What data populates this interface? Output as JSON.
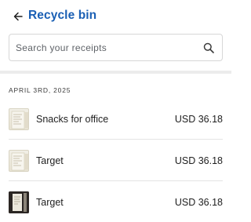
{
  "header": {
    "title": "Recycle bin"
  },
  "search": {
    "placeholder": "Search your receipts",
    "value": ""
  },
  "section": {
    "date_label": "April 3rd, 2025"
  },
  "receipts": [
    {
      "name": "Snacks for office",
      "amount": "USD 36.18",
      "thumbnail": "receipt-photo-light"
    },
    {
      "name": "Target",
      "amount": "USD 36.18",
      "thumbnail": "receipt-photo-light"
    },
    {
      "name": "Target",
      "amount": "USD 36.18",
      "thumbnail": "receipt-photo-dark"
    }
  ],
  "colors": {
    "accent": "#1a5fb4",
    "divider": "#e4e4e4"
  },
  "icons": {
    "back": "arrow-left-icon",
    "search": "search-icon"
  }
}
